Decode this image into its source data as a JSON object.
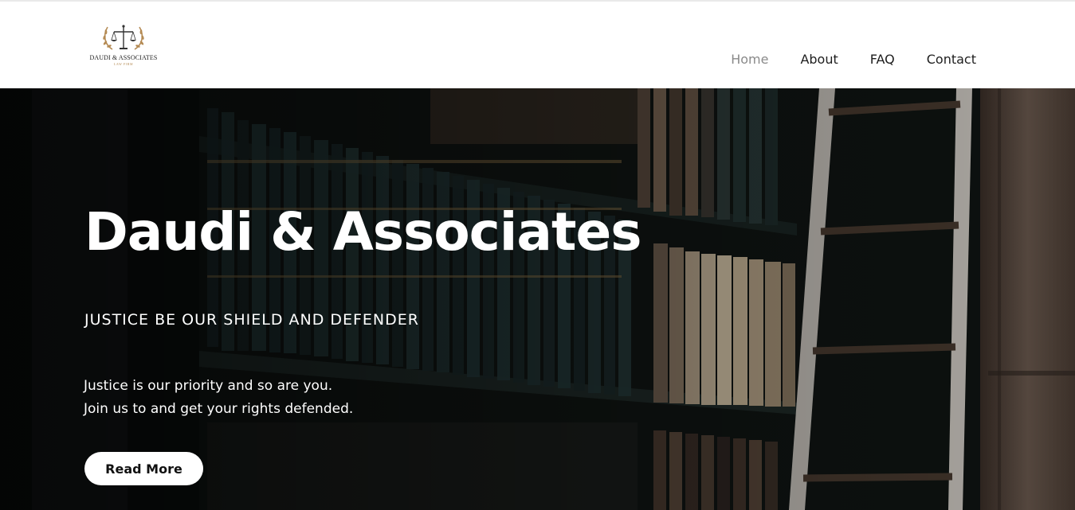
{
  "header": {
    "logo": {
      "icon": "scales-of-justice-laurel-icon",
      "title": "DAUDI & ASSOCIATES",
      "subtitle": "LAW FIRM"
    },
    "nav": [
      {
        "label": "Home",
        "active": true
      },
      {
        "label": "About",
        "active": false
      },
      {
        "label": "FAQ",
        "active": false
      },
      {
        "label": "Contact",
        "active": false
      }
    ]
  },
  "hero": {
    "background": "library-bookshelf-ladder-photo",
    "title": "Daudi & Associates",
    "tagline": "JUSTICE BE OUR SHIELD AND DEFENDER",
    "text_lines": [
      "Justice is our priority and so are you.",
      "Join us to and get your rights defended."
    ],
    "button_label": "Read More"
  },
  "colors": {
    "accent_gold": "#b48a53",
    "nav_text": "#1e1e1e",
    "nav_active": "#8a8a8a",
    "hero_text": "#ffffff"
  }
}
